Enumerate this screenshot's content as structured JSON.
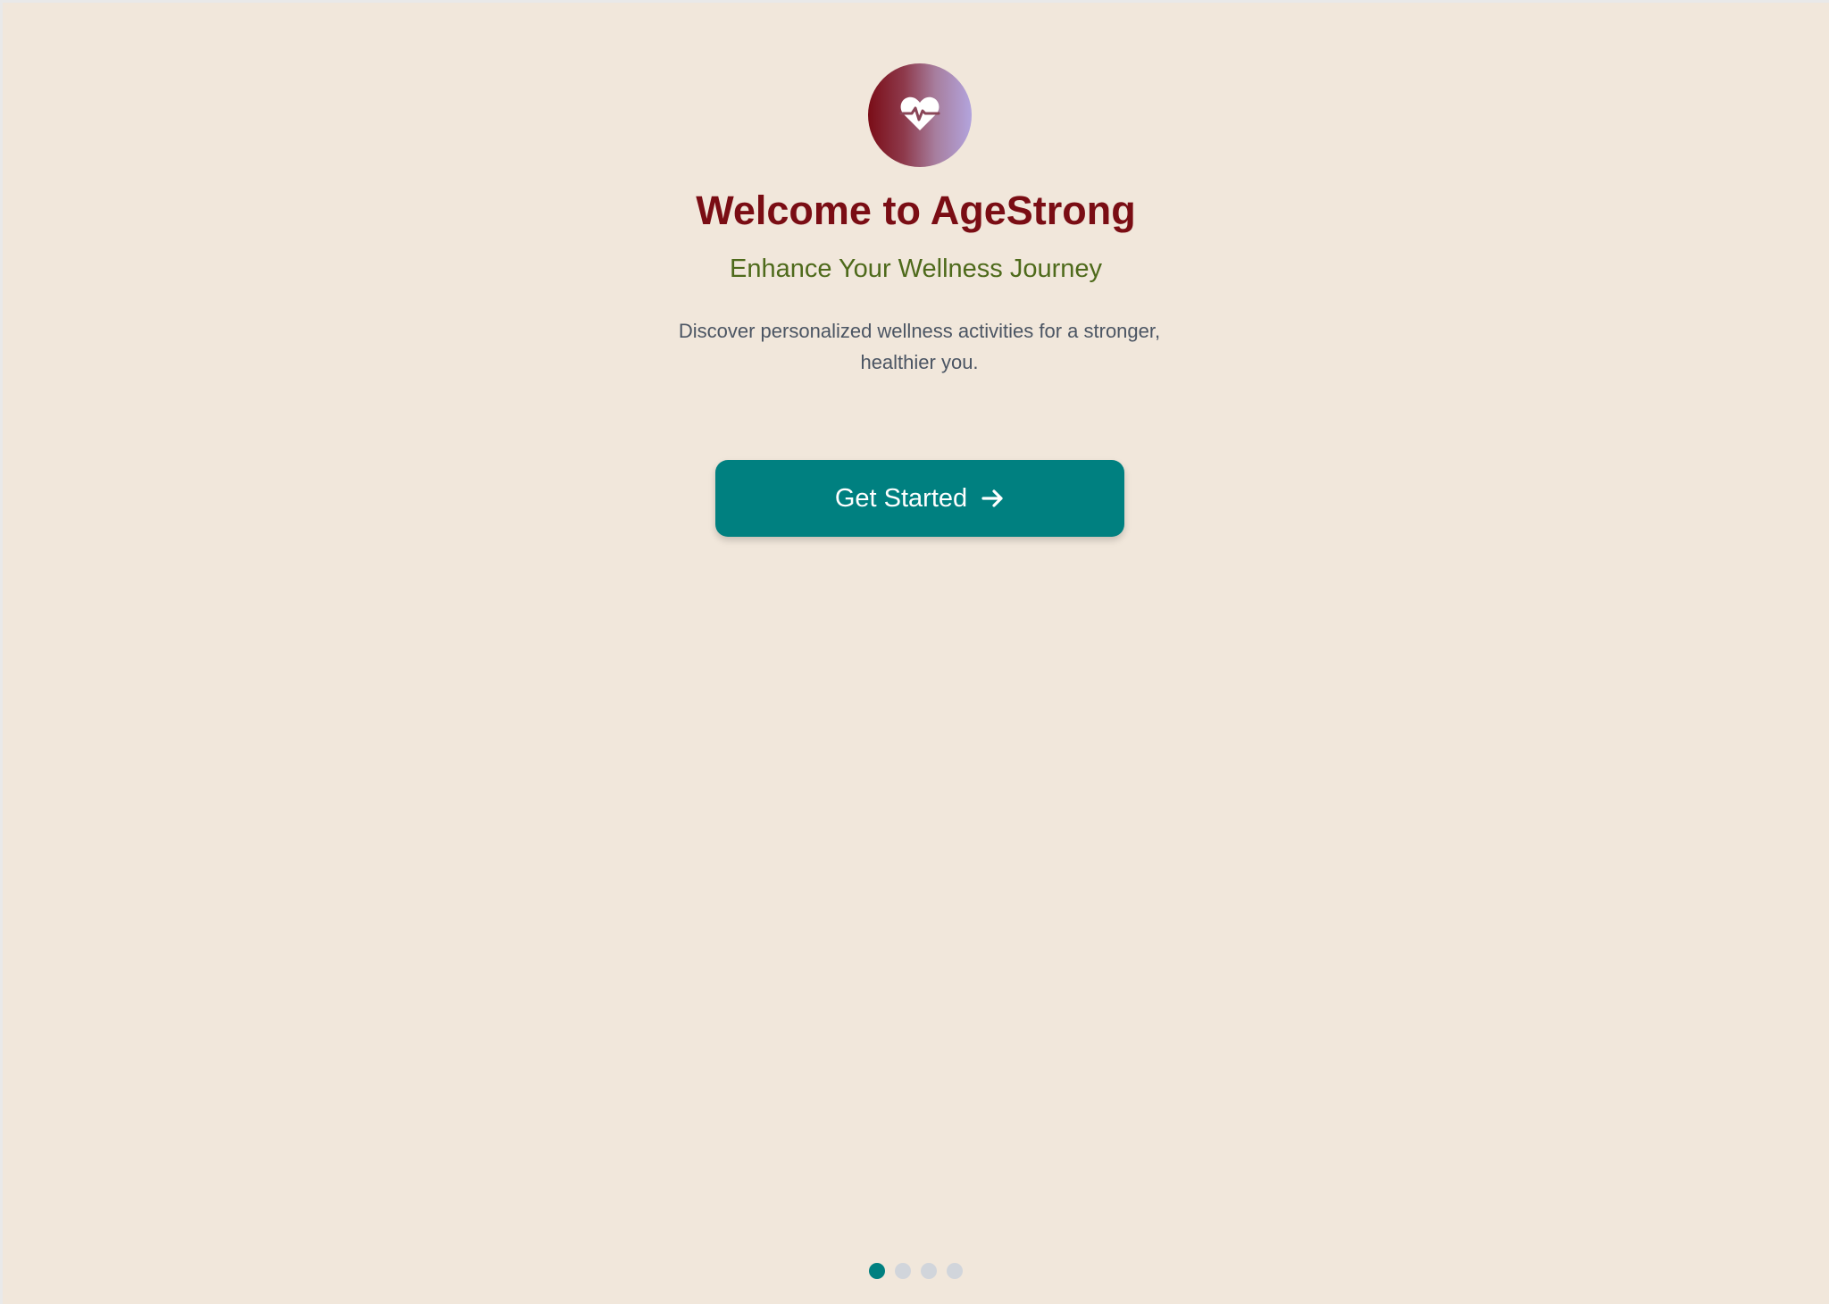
{
  "welcome": {
    "title": "Welcome to AgeStrong",
    "subtitle": "Enhance Your Wellness Journey",
    "description": "Discover personalized wellness activities for a stronger, healthier you.",
    "logo_icon": "heart-pulse-icon",
    "cta_label": "Get Started",
    "cta_icon": "arrow-right-icon"
  },
  "pagination": {
    "total": 4,
    "current": 1
  },
  "colors": {
    "background": "#f1e7db",
    "title": "#7a0d14",
    "subtitle": "#4e6a1b",
    "description": "#4b5563",
    "accent": "#008080",
    "dot_inactive": "#d1d5db"
  }
}
